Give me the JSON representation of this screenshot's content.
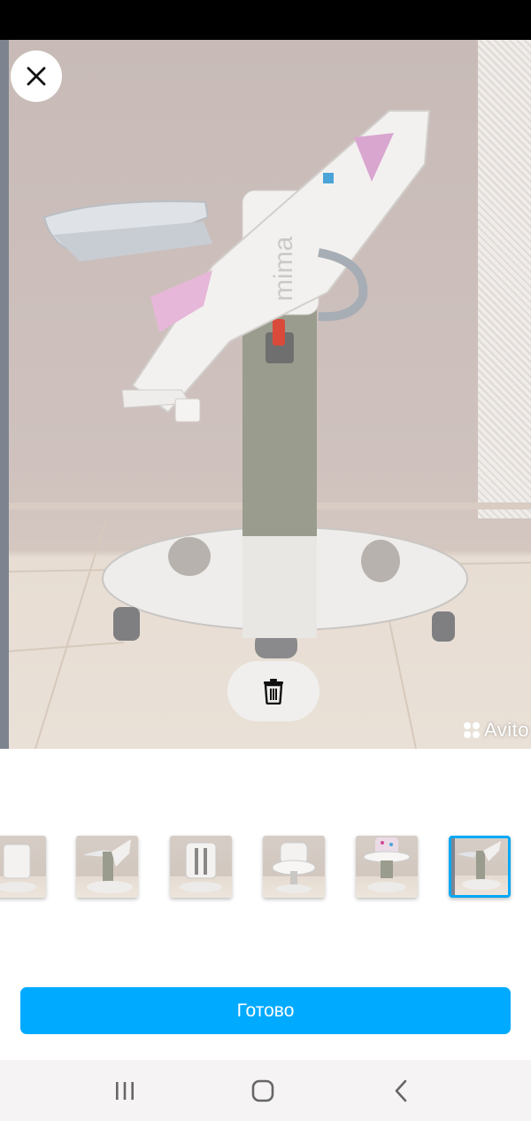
{
  "photo": {
    "watermark": "Avito",
    "brand_text": "mima"
  },
  "thumbnails": [
    {
      "name": "thumb-1",
      "selected": false
    },
    {
      "name": "thumb-2",
      "selected": false
    },
    {
      "name": "thumb-3",
      "selected": false
    },
    {
      "name": "thumb-4",
      "selected": false
    },
    {
      "name": "thumb-5",
      "selected": false
    },
    {
      "name": "thumb-6",
      "selected": true
    }
  ],
  "actions": {
    "done_label": "Готово"
  },
  "colors": {
    "accent": "#00aaff",
    "selected_border": "#00a8f4",
    "status_bar": "#000000",
    "nav_bar": "#f5f3f4"
  },
  "icons": [
    "close-icon",
    "trash-icon",
    "recent-apps-icon",
    "home-icon",
    "back-icon"
  ]
}
